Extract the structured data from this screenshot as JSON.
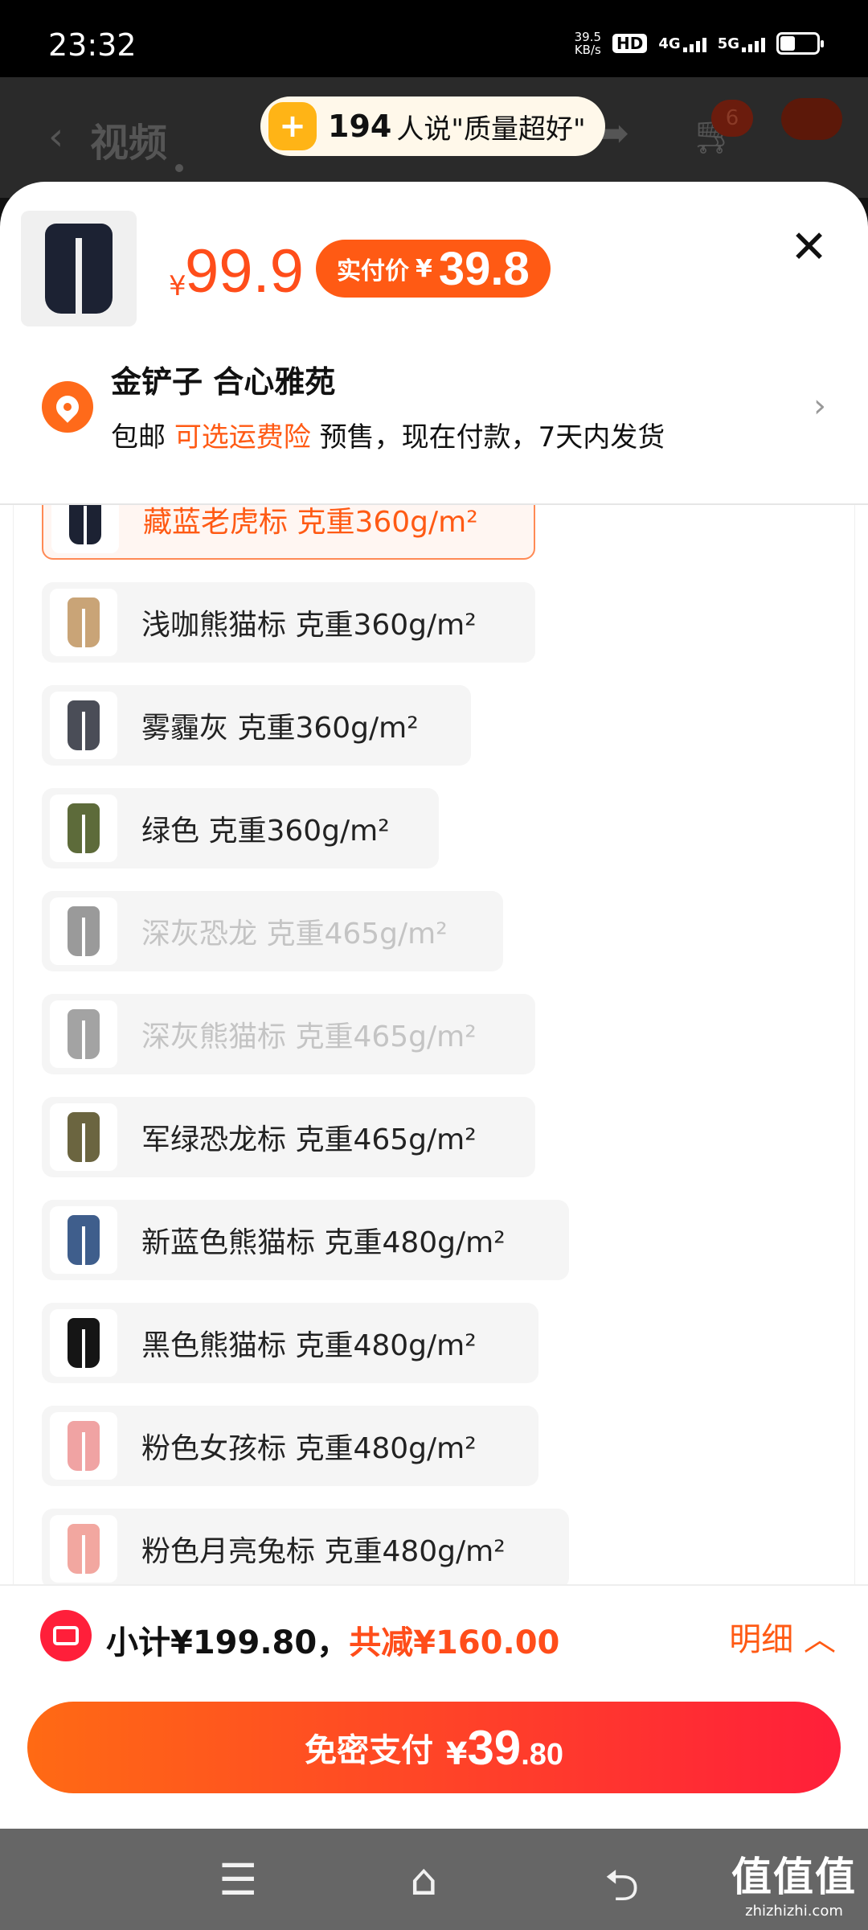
{
  "status_bar": {
    "time": "23:32",
    "net_speed_value": "39.5",
    "net_speed_unit": "KB/s",
    "hd_label": "HD",
    "signal_1": "4G",
    "signal_2": "5G"
  },
  "background": {
    "tab_1": "视频",
    "tab_2": "",
    "cart_badge": "6",
    "praise_count": "194",
    "praise_text": "人说\"质量超好\""
  },
  "product": {
    "price_symbol": "¥",
    "price": "99.9",
    "real_price_label": "实付价",
    "real_price_symbol": "¥",
    "real_price": "39.8"
  },
  "address": {
    "name": "金铲子 合心雅苑",
    "shipping_free": "包邮",
    "insurance": "可选运费险",
    "presale": "预售，现在付款，7天内发货"
  },
  "options": [
    {
      "label": "藏蓝老虎标 克重360g/m²",
      "state": "selected",
      "color": "#1c2233"
    },
    {
      "label": "浅咖熊猫标 克重360g/m²",
      "state": "normal",
      "color": "#c9a477"
    },
    {
      "label": "雾霾灰 克重360g/m²",
      "state": "normal",
      "color": "#4a4d57"
    },
    {
      "label": "绿色 克重360g/m²",
      "state": "normal",
      "color": "#5d6b3a"
    },
    {
      "label": "深灰恐龙 克重465g/m²",
      "state": "disabled",
      "color": "#9a9a9a"
    },
    {
      "label": "深灰熊猫标 克重465g/m²",
      "state": "disabled",
      "color": "#a3a3a3"
    },
    {
      "label": "军绿恐龙标 克重465g/m²",
      "state": "normal",
      "color": "#6b6540"
    },
    {
      "label": "新蓝色熊猫标 克重480g/m²",
      "state": "normal",
      "color": "#3f5e8c"
    },
    {
      "label": "黑色熊猫标 克重480g/m²",
      "state": "normal",
      "color": "#151515"
    },
    {
      "label": "粉色女孩标 克重480g/m²",
      "state": "normal",
      "color": "#f0a3a3"
    },
    {
      "label": "粉色月亮兔标 克重480g/m²",
      "state": "normal",
      "color": "#f2a7a0"
    }
  ],
  "bottom": {
    "subtotal": "小计¥199.80，",
    "discount": "共减¥160.00",
    "detail": "明细 ︿",
    "pay_label": "免密支付",
    "pay_symbol": "¥",
    "pay_int": "39",
    "pay_dec": ".80"
  },
  "nav": {
    "watermark": "值值值",
    "watermark_url": "zhizhizhi.com"
  },
  "colors": {
    "accent": "#ff5a14",
    "pay_gradient_start": "#ff6a14",
    "pay_gradient_end": "#ff1f3a"
  }
}
